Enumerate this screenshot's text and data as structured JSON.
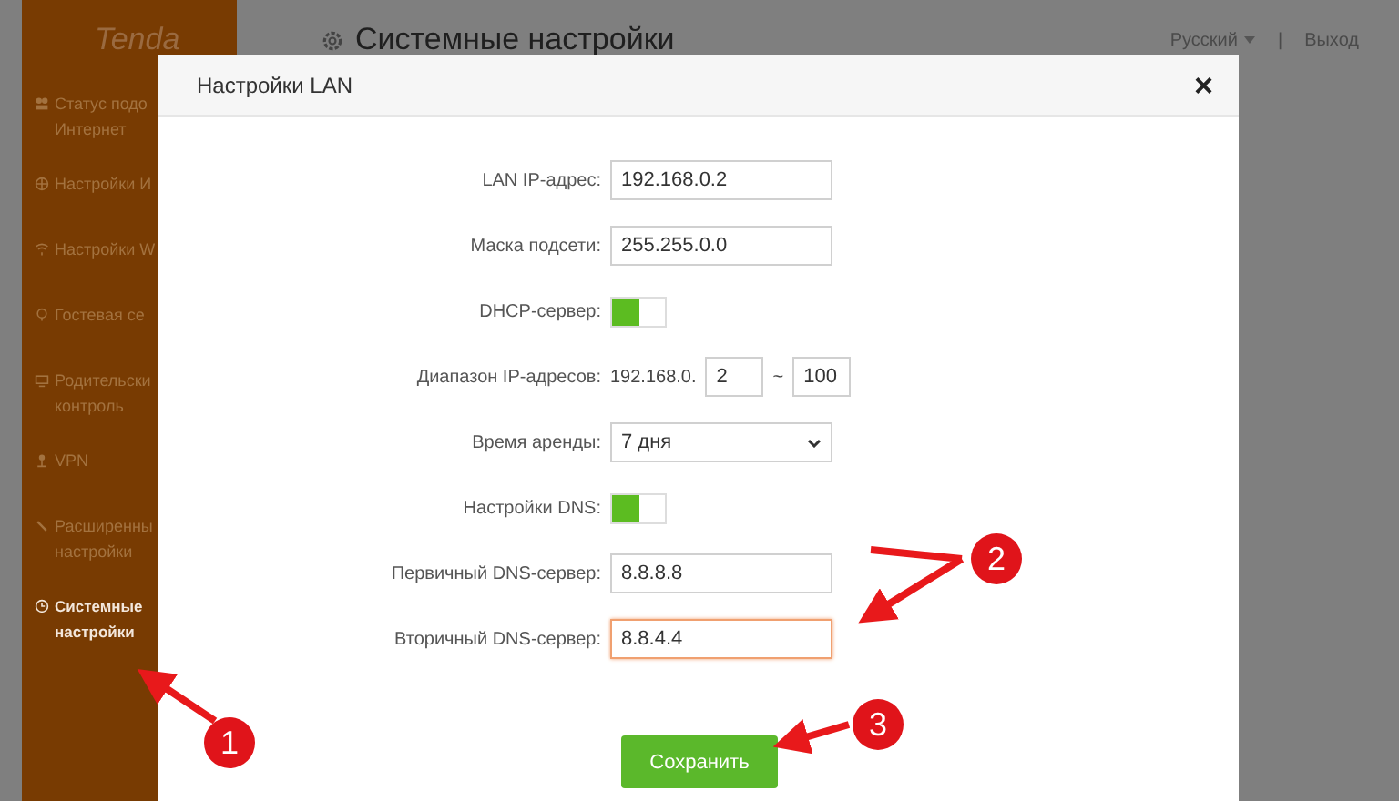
{
  "sidebar": {
    "logo": "Tenda",
    "items": [
      {
        "lines": [
          "Статус подо",
          "Интернет"
        ],
        "selected": false
      },
      {
        "lines": [
          "Настройки И"
        ],
        "selected": false
      },
      {
        "lines": [
          "Настройки W"
        ],
        "selected": false
      },
      {
        "lines": [
          "Гостевая се"
        ],
        "selected": false
      },
      {
        "lines": [
          "Родительски",
          "контроль"
        ],
        "selected": false
      },
      {
        "lines": [
          "VPN"
        ],
        "selected": false
      },
      {
        "lines": [
          "Расширенны",
          "настройки"
        ],
        "selected": false
      },
      {
        "lines": [
          "Системные",
          "настройки"
        ],
        "selected": true
      }
    ]
  },
  "page": {
    "title": "Системные настройки",
    "language": "Русский",
    "divider": "|",
    "logout": "Выход"
  },
  "dialog": {
    "title": "Настройки LAN",
    "close": "×",
    "fields": [
      {
        "kind": "text",
        "label": "LAN IP-адрес:",
        "value": "192.168.0.2",
        "focused": false
      },
      {
        "kind": "text",
        "label": "Маска подсети:",
        "value": "255.255.0.0",
        "focused": false
      },
      {
        "kind": "toggle",
        "label": "DHCP-сервер:",
        "on": true
      },
      {
        "kind": "range",
        "label": "Диапазон IP-адресов:",
        "prefix": "192.168.0.",
        "start": "2",
        "separator": "~",
        "end": "100"
      },
      {
        "kind": "select",
        "label": "Время аренды:",
        "value": "7 дня"
      },
      {
        "kind": "toggle",
        "label": "Настройки DNS:",
        "on": true
      },
      {
        "kind": "text",
        "label": "Первичный DNS-сервер:",
        "value": "8.8.8.8",
        "focused": false
      },
      {
        "kind": "text",
        "label": "Вторичный DNS-сервер:",
        "value": "8.8.4.4",
        "focused": true
      }
    ],
    "save": "Сохранить"
  },
  "callouts": [
    {
      "number": "1"
    },
    {
      "number": "2"
    },
    {
      "number": "3"
    }
  ]
}
